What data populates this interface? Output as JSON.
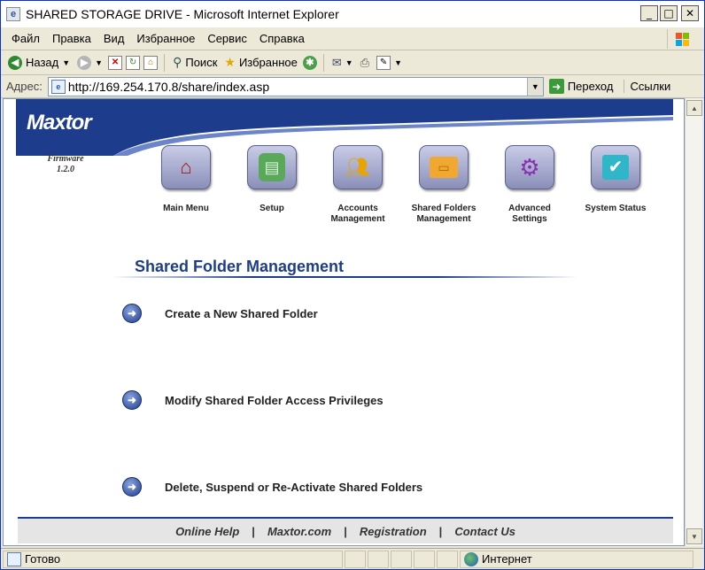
{
  "window": {
    "title": "SHARED STORAGE DRIVE - Microsoft Internet Explorer"
  },
  "menubar": {
    "items": [
      "Файл",
      "Правка",
      "Вид",
      "Избранное",
      "Сервис",
      "Справка"
    ]
  },
  "toolbar": {
    "back_label": "Назад",
    "search_label": "Поиск",
    "favorites_label": "Избранное"
  },
  "addressbar": {
    "label": "Адрес:",
    "url": "http://169.254.170.8/share/index.asp",
    "go_label": "Переход",
    "links_label": "Ссылки"
  },
  "header": {
    "logo": "Maxtor",
    "firmware_label": "Firmware",
    "firmware_version": "1.2.0"
  },
  "nav": [
    {
      "label": "Main Menu",
      "icon": "house-icon"
    },
    {
      "label": "Setup",
      "icon": "binder-icon"
    },
    {
      "label": "Accounts Management",
      "icon": "users-icon"
    },
    {
      "label": "Shared Folders Management",
      "icon": "folders-icon"
    },
    {
      "label": "Advanced Settings",
      "icon": "gears-icon"
    },
    {
      "label": "System Status",
      "icon": "checkmark-icon"
    }
  ],
  "main": {
    "title": "Shared Folder Management",
    "actions": [
      "Create a New Shared Folder",
      "Modify Shared Folder Access Privileges",
      "Delete, Suspend or Re-Activate Shared Folders"
    ]
  },
  "footer": {
    "links": [
      "Online Help",
      "Maxtor.com",
      "Registration",
      "Contact Us"
    ],
    "separator": "|"
  },
  "statusbar": {
    "status": "Готово",
    "zone": "Интернет"
  },
  "colors": {
    "brand_blue": "#1d3c8c",
    "titlebar": "#ffffff"
  }
}
